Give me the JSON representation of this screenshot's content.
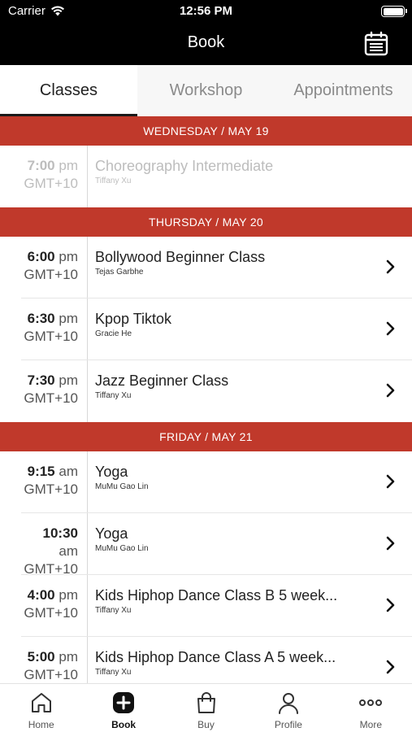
{
  "status_bar": {
    "carrier": "Carrier",
    "time": "12:56 PM"
  },
  "header": {
    "title": "Book"
  },
  "tabs": [
    {
      "label": "Classes",
      "active": true
    },
    {
      "label": "Workshop",
      "active": false
    },
    {
      "label": "Appointments",
      "active": false
    }
  ],
  "days": [
    {
      "label": "WEDNESDAY / MAY 19",
      "classes": [
        {
          "time": "7:00",
          "ampm": "pm",
          "tz": "GMT+10",
          "name": "Choreography Intermediate",
          "teacher": "Tiffany Xu",
          "past": true
        }
      ]
    },
    {
      "label": "THURSDAY / MAY 20",
      "classes": [
        {
          "time": "6:00",
          "ampm": "pm",
          "tz": "GMT+10",
          "name": "Bollywood Beginner Class",
          "teacher": "Tejas Garbhe",
          "past": false
        },
        {
          "time": "6:30",
          "ampm": "pm",
          "tz": "GMT+10",
          "name": "Kpop Tiktok",
          "teacher": "Gracie He",
          "past": false
        },
        {
          "time": "7:30",
          "ampm": "pm",
          "tz": "GMT+10",
          "name": "Jazz Beginner Class",
          "teacher": "Tiffany Xu",
          "past": false
        }
      ]
    },
    {
      "label": "FRIDAY / MAY 21",
      "classes": [
        {
          "time": "9:15",
          "ampm": "am",
          "tz": "GMT+10",
          "name": "Yoga",
          "teacher": "MuMu Gao Lin",
          "past": false
        },
        {
          "time": "10:30",
          "ampm": "am",
          "tz": "GMT+10",
          "name": "Yoga",
          "teacher": "MuMu Gao Lin",
          "past": false
        },
        {
          "time": "4:00",
          "ampm": "pm",
          "tz": "GMT+10",
          "name": "Kids Hiphop Dance Class B 5 week...",
          "teacher": "Tiffany Xu",
          "past": false
        },
        {
          "time": "5:00",
          "ampm": "pm",
          "tz": "GMT+10",
          "name": "Kids Hiphop Dance Class A 5 week...",
          "teacher": "Tiffany Xu",
          "past": false
        }
      ]
    }
  ],
  "tab_bar": [
    {
      "label": "Home",
      "icon": "home-icon",
      "active": false
    },
    {
      "label": "Book",
      "icon": "book-plus-icon",
      "active": true
    },
    {
      "label": "Buy",
      "icon": "shopping-bag-icon",
      "active": false
    },
    {
      "label": "Profile",
      "icon": "profile-icon",
      "active": false
    },
    {
      "label": "More",
      "icon": "more-icon",
      "active": false
    }
  ],
  "colors": {
    "accent": "#c0392b",
    "header_bg": "#000000"
  }
}
